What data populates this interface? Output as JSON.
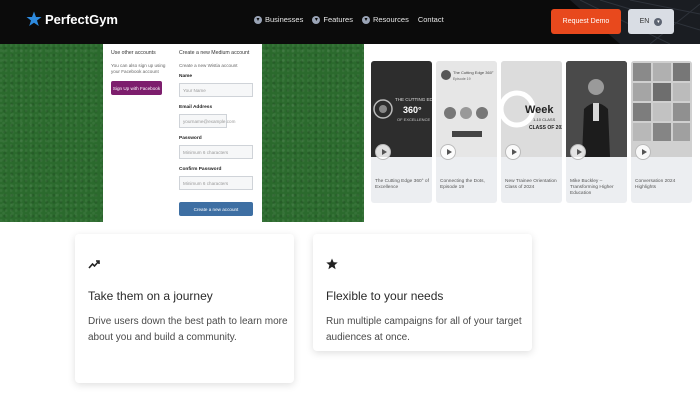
{
  "header": {
    "logo_text": "PerfectGym",
    "nav": [
      {
        "label": "Businesses",
        "icon": "chevron-down-icon"
      },
      {
        "label": "Features",
        "icon": "chevron-down-icon"
      },
      {
        "label": "Resources",
        "icon": "chevron-down-icon"
      },
      {
        "label": "Contact"
      }
    ],
    "demo_button": "Request Demo",
    "lang_button": "EN",
    "colors": {
      "background": "#0b0b0b",
      "accent": "#e8491d"
    }
  },
  "form": {
    "social_heading": "Use other accounts",
    "social_text": "You can also sign up using your Facebook account",
    "facebook_button": "Sign Up with Facebook",
    "create_heading": "Create a new Medium account",
    "create_text": "Create a new Wistia account",
    "fields": [
      {
        "label": "Name",
        "placeholder": "Your Name"
      },
      {
        "label": "Email Address",
        "placeholder": "yourname@example.com"
      },
      {
        "label": "Password",
        "placeholder": "Minimum 6 characters"
      },
      {
        "label": "Confirm Password",
        "placeholder": "Minimum 6 characters"
      }
    ],
    "create_button": "Create a new account"
  },
  "videos": [
    {
      "title": "The Cutting Edge 360° of Excellence",
      "thumb_text": "THE CUTTING EDGE 360° OF EXCELLENCE"
    },
    {
      "title": "Connecting the Dots, Episode 19",
      "thumb_text": "The Cutting Edge 360° Episode 19"
    },
    {
      "title": "New Trainee Orientation Class of 2024",
      "thumb_text": "Week 1-10 CLASS OF 2024"
    },
    {
      "title": "Mike Buckley – Transforming Higher Education",
      "thumb_text": ""
    },
    {
      "title": "Conversation 2024 Highlights",
      "thumb_text": ""
    }
  ],
  "features": [
    {
      "icon": "trending-up-icon",
      "title": "Take them on a journey",
      "description": "Drive users down the best path to learn more about you and build a community."
    },
    {
      "icon": "star-icon",
      "title": "Flexible to your needs",
      "description": "Run multiple campaigns for all of your target audiences at once."
    }
  ]
}
